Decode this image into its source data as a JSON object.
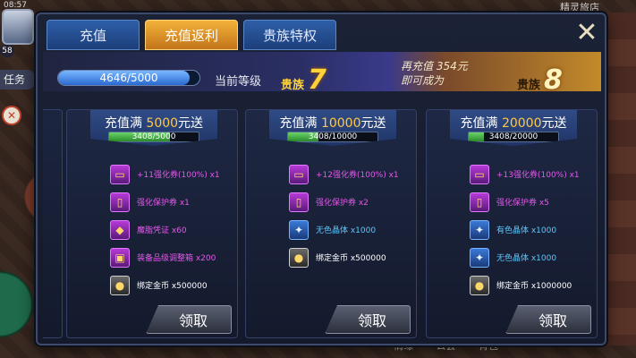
{
  "status_bar": {
    "time": "08:57"
  },
  "game": {
    "top_right_label": "精灵旅店",
    "player_level": "58",
    "task_label": "任务",
    "bottom_menu": [
      "情缘",
      "公会",
      "背包"
    ]
  },
  "dialog": {
    "tabs": [
      {
        "label": "充值",
        "active": false
      },
      {
        "label": "充值返利",
        "active": true
      },
      {
        "label": "贵族特权",
        "active": false
      }
    ],
    "close_label": "✕",
    "level": {
      "progress_text": "4646/5000",
      "progress_value": 0.9292,
      "current_label": "当前等级",
      "vip_word": "贵族",
      "current_level": "7",
      "next_line1": "再充值  354元",
      "next_line2": "即可成为",
      "next_level": "8"
    },
    "cards": [
      {
        "title_prefix": "充值满 ",
        "amount": "5000",
        "title_suffix": "元送",
        "progress_text": "3408/5000",
        "progress_value": 0.6816,
        "claim_label": "领取",
        "rewards": [
          {
            "icon": "ticket-icon",
            "glyph": "▭",
            "quality": "purple",
            "text": "+11强化券(100%) x1"
          },
          {
            "icon": "scroll-icon",
            "glyph": "▯",
            "quality": "purple",
            "text": "强化保护券 x1"
          },
          {
            "icon": "voucher-icon",
            "glyph": "◆",
            "quality": "purple",
            "text": "魔脂凭证 x60"
          },
          {
            "icon": "chest-icon",
            "glyph": "▣",
            "quality": "purple",
            "text": "装备品级调整箱 x200"
          },
          {
            "icon": "coin-icon",
            "glyph": "●",
            "quality": "white",
            "text": "绑定金币 x500000"
          }
        ]
      },
      {
        "title_prefix": "充值满 ",
        "amount": "10000",
        "title_suffix": "元送",
        "progress_text": "3408/10000",
        "progress_value": 0.3408,
        "claim_label": "领取",
        "rewards": [
          {
            "icon": "ticket-icon",
            "glyph": "▭",
            "quality": "purple",
            "text": "+12强化券(100%) x1"
          },
          {
            "icon": "scroll-icon",
            "glyph": "▯",
            "quality": "purple",
            "text": "强化保护券 x2"
          },
          {
            "icon": "crystal-icon",
            "glyph": "✦",
            "quality": "blue",
            "text": "无色晶体 x1000"
          },
          {
            "icon": "coin-icon",
            "glyph": "●",
            "quality": "white",
            "text": "绑定金币 x500000"
          }
        ]
      },
      {
        "title_prefix": "充值满 ",
        "amount": "20000",
        "title_suffix": "元送",
        "progress_text": "3408/20000",
        "progress_value": 0.1704,
        "claim_label": "领取",
        "rewards": [
          {
            "icon": "ticket-icon",
            "glyph": "▭",
            "quality": "purple",
            "text": "+13强化券(100%) x1"
          },
          {
            "icon": "scroll-icon",
            "glyph": "▯",
            "quality": "purple",
            "text": "强化保护券 x5"
          },
          {
            "icon": "crystal-icon",
            "glyph": "✦",
            "quality": "blue",
            "text": "有色晶体 x1000"
          },
          {
            "icon": "crystal-icon",
            "glyph": "✦",
            "quality": "blue",
            "text": "无色晶体 x1000"
          },
          {
            "icon": "coin-icon",
            "glyph": "●",
            "quality": "white",
            "text": "绑定金币 x1000000"
          }
        ]
      }
    ]
  },
  "colors": {
    "tab_active": "#f3b23a",
    "tab_inactive": "#2e5ea8",
    "vip_gold": "#ffd23a",
    "quality_purple": "#e05ae8",
    "quality_blue": "#5ac8ff"
  }
}
